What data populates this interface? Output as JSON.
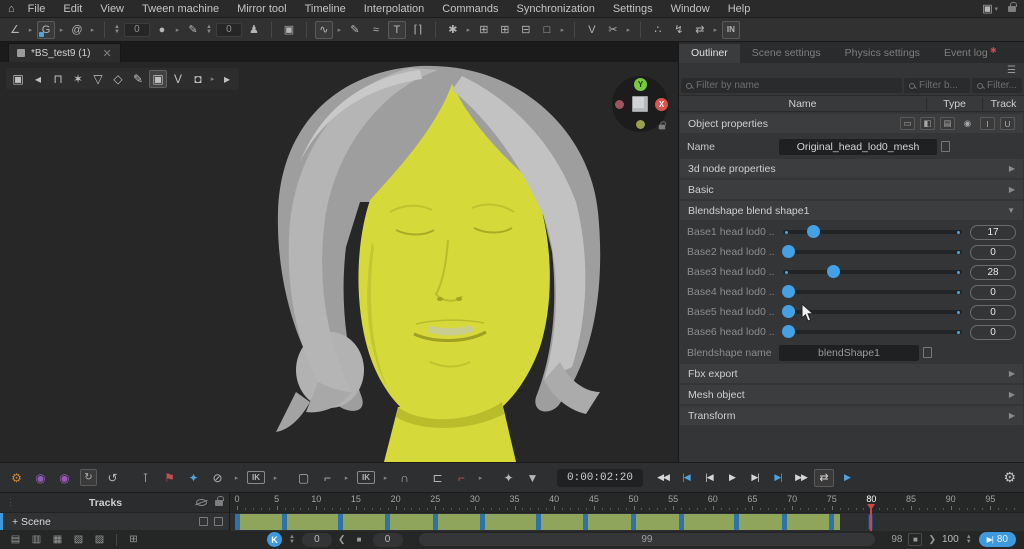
{
  "colors": {
    "accent_blue": "#3d9ae0",
    "slider_knob": "#45a1e6",
    "timeline_green": "#8fa55c",
    "keyframe_blue": "#2f72a8",
    "playhead_red": "#cf4545",
    "selection_yellow": "#d5d93a",
    "hair_gray": "#b5b5b5",
    "flag_red": "#c0504d",
    "physics_orange": "#cc8a3d",
    "ghost_purple": "#9b59b6"
  },
  "menu": {
    "items": [
      "File",
      "Edit",
      "View",
      "Tween machine",
      "Mirror tool",
      "Timeline",
      "Interpolation",
      "Commands",
      "Synchronization",
      "Settings",
      "Window",
      "Help"
    ]
  },
  "main_toolbar": [
    {
      "name": "graph-editor-icon",
      "glyph": "∠",
      "dropdown": true
    },
    {
      "name": "ghost-mode-icon",
      "glyph": "G",
      "boxed": true,
      "dropdown": true,
      "badge": "#4da3e0"
    },
    {
      "name": "autoposing-spiral-icon",
      "glyph": "@",
      "dropdown": true
    },
    {
      "divider": true
    },
    {
      "name": "frame-count-field",
      "field": "0",
      "stepper": true
    },
    {
      "name": "keyframe-dot-icon",
      "glyph": "●",
      "dropdown": true
    },
    {
      "name": "pen-icon",
      "glyph": "✎"
    },
    {
      "name": "interval-field",
      "field": "0",
      "stepper": true
    },
    {
      "name": "character-icon",
      "glyph": "♟"
    },
    {
      "divider": true
    },
    {
      "name": "copy-pose-icon",
      "glyph": "▣"
    },
    {
      "divider": true
    },
    {
      "name": "interpolation-curve-icon",
      "glyph": "∿",
      "boxed": true,
      "dropdown": true
    },
    {
      "name": "edit-curve-icon",
      "glyph": "✎"
    },
    {
      "name": "tween-curves-icon",
      "glyph": "≈"
    },
    {
      "name": "text-tool-icon",
      "glyph": "T",
      "boxed": true
    },
    {
      "name": "brackets-icon",
      "glyph": "⌈⌉"
    },
    {
      "divider": true
    },
    {
      "name": "animation-mode-icon",
      "glyph": "✱",
      "dropdown": true
    },
    {
      "name": "grid-view-icon",
      "glyph": "⊞"
    },
    {
      "name": "add-window-icon",
      "glyph": "⊞"
    },
    {
      "name": "remove-window-icon",
      "glyph": "⊟"
    },
    {
      "name": "window-layout-icon",
      "glyph": "□",
      "dropdown": true
    },
    {
      "divider": true
    },
    {
      "name": "cascadeur-logo-icon",
      "glyph": "V"
    },
    {
      "name": "cut-pose-icon",
      "glyph": "✂",
      "dropdown": true
    },
    {
      "divider": true
    },
    {
      "name": "footsteps-icon",
      "glyph": "∴"
    },
    {
      "name": "runner-icon",
      "glyph": "↯"
    },
    {
      "name": "track-spacing-icon",
      "glyph": "⇄",
      "dropdown": true
    },
    {
      "name": "in-badge",
      "glyph": "IN",
      "boxed": true
    }
  ],
  "menubar_right": [
    {
      "name": "window-layout-icon",
      "glyph": "▣",
      "dropdown": true
    },
    {
      "name": "lock-icon",
      "lock": true
    }
  ],
  "viewport": {
    "tab_title": "*BS_test9 (1)",
    "toolbar": [
      {
        "name": "view-cube-icon",
        "glyph": "▣"
      },
      {
        "name": "collapse-arrow-icon",
        "glyph": "◂"
      },
      {
        "name": "easel-icon",
        "glyph": "⊓"
      },
      {
        "name": "joints-icon",
        "glyph": "✶"
      },
      {
        "name": "point-net-icon",
        "glyph": "▽"
      },
      {
        "name": "polygon-icon",
        "glyph": "◇"
      },
      {
        "name": "normals-pen-icon",
        "glyph": "✎"
      },
      {
        "name": "mesh-cube-icon",
        "glyph": "▣",
        "selected": true
      },
      {
        "name": "visual-v-icon",
        "glyph": "V"
      },
      {
        "name": "camera-icon",
        "glyph": "◘",
        "dropdown": true
      },
      {
        "name": "expand-arrow-icon",
        "glyph": "▸"
      }
    ],
    "gizmo": {
      "x_label": "X",
      "y_label": "Y"
    }
  },
  "right_panel": {
    "tabs": [
      {
        "label": "Outliner",
        "active": true
      },
      {
        "label": "Scene settings",
        "active": false
      },
      {
        "label": "Physics settings",
        "active": false
      },
      {
        "label": "Event log",
        "active": false,
        "badge": true
      }
    ],
    "filters": {
      "by_name": "Filter by name",
      "by_type": "Filter b...",
      "by_track": "Filter..."
    },
    "columns": {
      "name": "Name",
      "type": "Type",
      "track": "Track"
    },
    "object_properties": {
      "title": "Object properties",
      "icons": [
        {
          "name": "isolate-icon",
          "glyph": "▭",
          "boxed": true
        },
        {
          "name": "split-view-icon",
          "glyph": "◧",
          "boxed": true
        },
        {
          "name": "list-view-icon",
          "glyph": "▤",
          "boxed": true
        },
        {
          "name": "visibility-eye-icon",
          "glyph": "◉"
        },
        {
          "name": "interpolation-i-icon",
          "glyph": "I",
          "boxed": true
        },
        {
          "name": "update-u-icon",
          "glyph": "U",
          "boxed": true
        }
      ],
      "name_label": "Name",
      "name_value": "Original_head_lod0_mesh"
    },
    "sections_top": [
      {
        "label": "3d  node  properties",
        "expanded": false
      },
      {
        "label": "Basic",
        "expanded": false
      },
      {
        "label": "Blendshape blend shape1",
        "expanded": true
      }
    ],
    "blendshape_sliders": [
      {
        "label": "Base1 head lod0 ...",
        "value": 17
      },
      {
        "label": "Base2 head lod0 ...",
        "value": 0
      },
      {
        "label": "Base3 head lod0 ...",
        "value": 28
      },
      {
        "label": "Base4 head lod0 ...",
        "value": 0
      },
      {
        "label": "Base5 head lod0 ...",
        "value": 0
      },
      {
        "label": "Base6 head lod0 ...",
        "value": 0
      }
    ],
    "blendshape_name": {
      "label": "Blendshape name",
      "value": "blendShape1"
    },
    "sections_bottom": [
      "Fbx export",
      "Mesh object",
      "Transform"
    ]
  },
  "playback": {
    "groups": [
      [
        {
          "name": "physics-gear-icon",
          "glyph": "⚙",
          "color": "#cc8a3d"
        },
        {
          "name": "ghost-a-icon",
          "glyph": "◉",
          "color": "#8e5fb5"
        },
        {
          "name": "ghost-b-icon",
          "glyph": "◉",
          "color": "#9b59b6"
        },
        {
          "name": "loop-interval-icon",
          "glyph": "↻",
          "boxed": true
        },
        {
          "name": "reset-interval-icon",
          "glyph": "↺"
        }
      ],
      [
        {
          "name": "pin-icon",
          "glyph": "⊺"
        },
        {
          "name": "flag-icon",
          "glyph": "⚑",
          "color": "#c0504d"
        },
        {
          "name": "delete-key-icon",
          "glyph": "✦",
          "color": "#4da3e0"
        },
        {
          "name": "ban-icon",
          "glyph": "⊘",
          "dropdown": true
        },
        {
          "name": "ik-badge",
          "glyph": "IK",
          "badge": true,
          "dropdown": true
        }
      ],
      [
        {
          "name": "select-box-icon",
          "glyph": "▢"
        },
        {
          "name": "step-mode-icon",
          "glyph": "⌐",
          "dropdown": true
        },
        {
          "name": "ik-fk-badge",
          "glyph": "IK",
          "badge": true,
          "dropdown": true
        },
        {
          "name": "audio-sync-icon",
          "glyph": "∩"
        }
      ],
      [
        {
          "name": "clamp-icon",
          "glyph": "⊏"
        },
        {
          "name": "tangent-step-icon",
          "glyph": "⌐",
          "color": "#c0504d",
          "dropdown": true
        }
      ],
      [
        {
          "name": "brush-key-icon",
          "glyph": "✦"
        },
        {
          "name": "funnel-icon",
          "glyph": "▼"
        }
      ]
    ],
    "timecode": "0:00:02:20",
    "transport": [
      {
        "name": "rewind-button",
        "glyph": "◀◀"
      },
      {
        "name": "jump-start-button",
        "glyph": "|◀",
        "accent": true
      },
      {
        "name": "prev-frame-button",
        "glyph": "|◀"
      },
      {
        "name": "play-button",
        "glyph": "▶"
      },
      {
        "name": "next-frame-button",
        "glyph": "▶|"
      },
      {
        "name": "jump-end-button",
        "glyph": "▶|",
        "accent": true
      },
      {
        "name": "fast-forward-button",
        "glyph": "▶▶"
      },
      {
        "name": "loop-playback-button",
        "glyph": "⇄",
        "boxed": true
      },
      {
        "name": "play-physics-button",
        "glyph": "▶",
        "accent": true
      }
    ],
    "settings_gear": "⚙"
  },
  "timeline": {
    "tracks_header": "Tracks",
    "scene_row_label": "+ Scene",
    "tick_numbers": [
      0,
      5,
      10,
      15,
      20,
      25,
      30,
      35,
      40,
      45,
      50,
      55,
      60,
      65,
      70,
      75,
      80,
      85,
      90,
      95
    ],
    "max_frame": 100,
    "keyframes": [
      0,
      6,
      13,
      19,
      25,
      31,
      38,
      44,
      50,
      56,
      63,
      69,
      75
    ],
    "lone_keyframe": 80,
    "green_start": 0,
    "green_end": 76,
    "playhead": 80
  },
  "status_bar": {
    "track_icons": [
      {
        "name": "add-track-icon",
        "glyph": "▤"
      },
      {
        "name": "add-subtrack-icon",
        "glyph": "▥"
      },
      {
        "name": "remove-track-icon",
        "glyph": "▦"
      },
      {
        "name": "duplicate-track-icon",
        "glyph": "▧"
      },
      {
        "name": "export-track-icon",
        "glyph": "▨"
      },
      {
        "name": "merge-track-icon",
        "glyph": "⊞"
      }
    ],
    "key_button_label": "K",
    "offset_value": "0",
    "secondary_value": "0",
    "range_label": "99",
    "end_frame": "98",
    "total_frames": "100",
    "current_frame": "80"
  }
}
